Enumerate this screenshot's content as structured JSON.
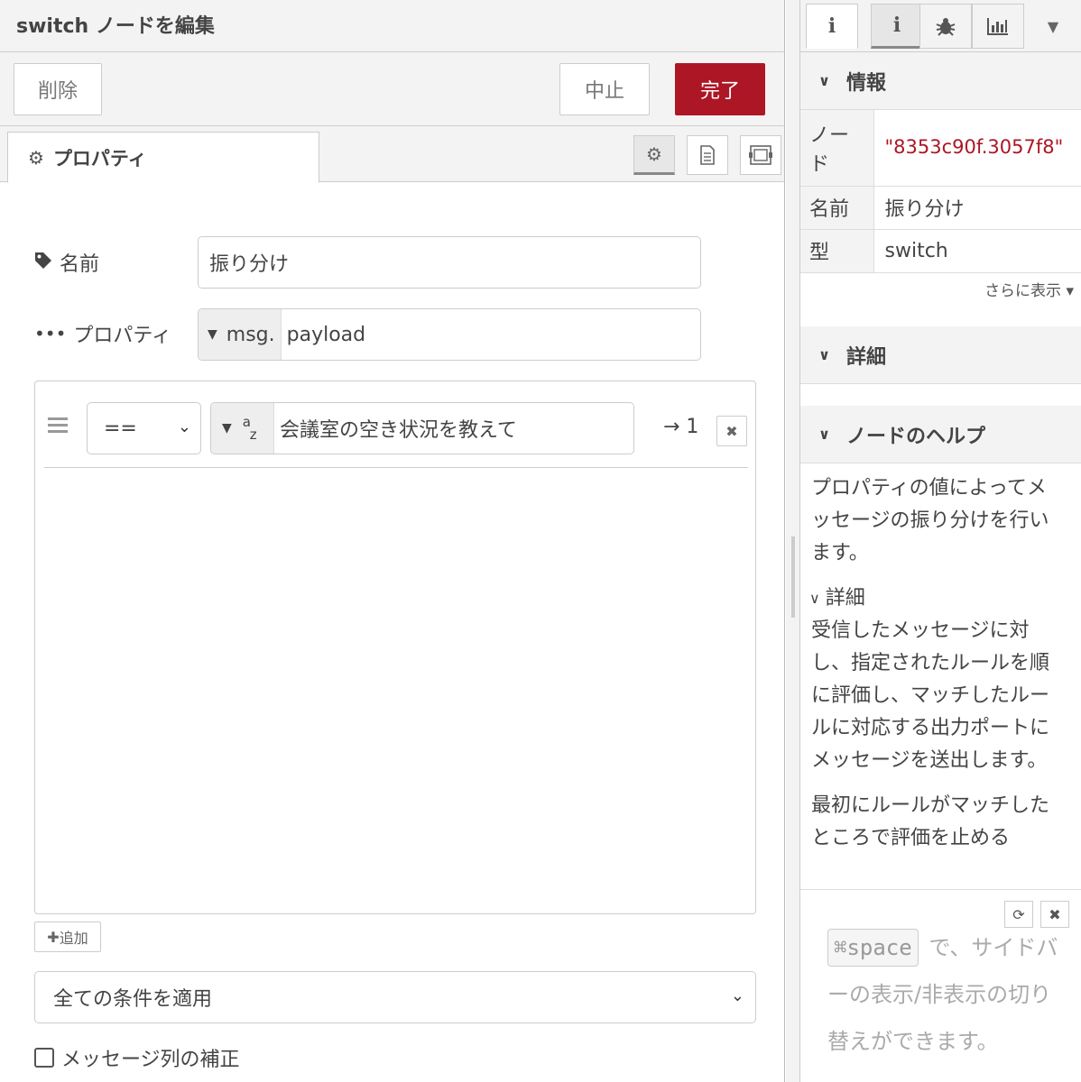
{
  "editor": {
    "title": "switch ノードを編集",
    "delete_label": "削除",
    "cancel_label": "中止",
    "done_label": "完了",
    "tab_properties": "プロパティ",
    "name_label": "名前",
    "name_value": "振り分け",
    "property_label": "プロパティ",
    "property_prefix": "msg.",
    "property_value": "payload",
    "rule": {
      "operator": "==",
      "value": "会議室の空き状況を教えて",
      "output": "→ 1"
    },
    "add_label": "追加",
    "check_all": "全ての条件を適用",
    "repair_label": "メッセージ列の補正"
  },
  "sidebar": {
    "info_header": "情報",
    "node_key": "ノード",
    "node_id": "\"8353c90f.3057f8\"",
    "name_key": "名前",
    "name_value": "振り分け",
    "type_key": "型",
    "type_value": "switch",
    "more_label": "さらに表示 ▾",
    "details_header": "詳細",
    "help_header": "ノードのヘルプ",
    "help_p1": "プロパティの値によってメッセージの振り分けを行います。",
    "help_subhead": "詳細",
    "help_p2": "受信したメッセージに対し、指定されたルールを順に評価し、マッチしたルールに対応する出力ポートにメッセージを送出します。",
    "help_p3": "最初にルールがマッチしたところで評価を止める",
    "shortcut_key": "⌘space",
    "shortcut_text": " で、サイドバーの表示/非表示の切り替えができます。"
  },
  "icons": {
    "gear": "gear-icon",
    "tag": "tag-icon",
    "ellipsis": "ellipsis-icon",
    "info": "info-icon",
    "bug": "bug-icon",
    "chart": "chart-icon"
  },
  "colors": {
    "primary": "#ad1625",
    "node_id": "#ad1625"
  }
}
